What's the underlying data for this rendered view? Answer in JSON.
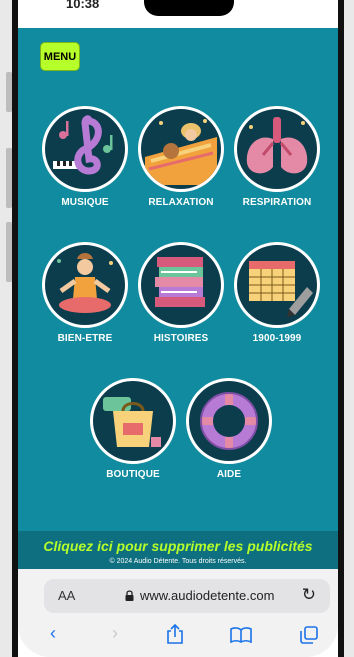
{
  "status_bar": {
    "time": "10:38"
  },
  "site": {
    "menu_label": "MENU",
    "tiles": [
      {
        "label": "MUSIQUE",
        "icon": "treble-clef-icon"
      },
      {
        "label": "RELAXATION",
        "icon": "sleeping-woman-icon"
      },
      {
        "label": "RESPIRATION",
        "icon": "lungs-icon"
      },
      {
        "label": "BIEN-ETRE",
        "icon": "yoga-woman-icon"
      },
      {
        "label": "HISTOIRES",
        "icon": "books-icon"
      },
      {
        "label": "1900-1999",
        "icon": "calendar-pencil-icon"
      },
      {
        "label": "BOUTIQUE",
        "icon": "shopping-bag-icon"
      },
      {
        "label": "AIDE",
        "icon": "lifebuoy-icon"
      }
    ],
    "ad_banner": "Cliquez ici pour supprimer les publicités",
    "copyright": "© 2024 Audio Détente. Tous droits réservés."
  },
  "browser": {
    "aa_label": "AA",
    "url": "www.audiodetente.com",
    "reload_icon": "reload-icon",
    "toolbar_icons": [
      "back-icon",
      "forward-icon",
      "share-icon",
      "bookmarks-icon",
      "tabs-icon"
    ]
  },
  "colors": {
    "site_background": "#118b9f",
    "menu_button": "#b6ff2a",
    "ad_text": "#b6ff2a",
    "browser_accent": "#1a73e8"
  }
}
